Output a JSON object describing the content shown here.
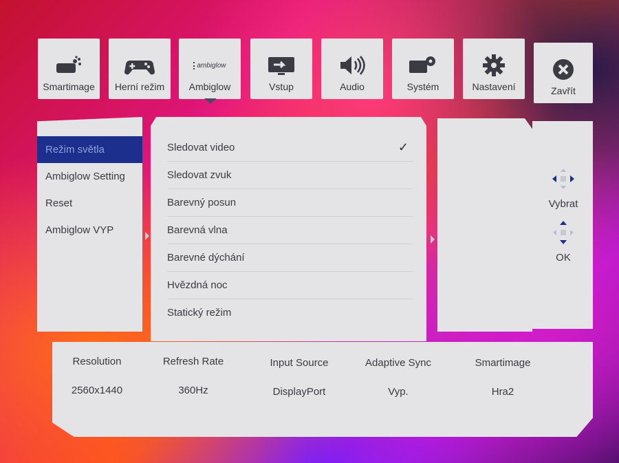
{
  "tabs": [
    {
      "label": "Smartimage",
      "icon": "smartimage-icon"
    },
    {
      "label": "Herní režim",
      "icon": "gamepad-icon"
    },
    {
      "label": "Ambiglow",
      "icon": "ambiglow-logo-icon",
      "logo_text": "ambiglow"
    },
    {
      "label": "Vstup",
      "icon": "input-icon"
    },
    {
      "label": "Audio",
      "icon": "speaker-icon"
    },
    {
      "label": "Systém",
      "icon": "system-icon"
    },
    {
      "label": "Nastavení",
      "icon": "gear-icon"
    },
    {
      "label": "Zavřít",
      "icon": "close-icon"
    }
  ],
  "active_tab": "Ambiglow",
  "left_menu": [
    "Režim světla",
    "Ambiglow Setting",
    "Reset",
    "Ambiglow VYP"
  ],
  "left_selected": "Režim světla",
  "mid_menu": [
    "Sledovat video",
    "Sledovat zvuk",
    "Barevný posun",
    "Barevná vlna",
    "Barevné dýchání",
    "Hvězdná noc",
    "Statický režim"
  ],
  "mid_checked": "Sledovat video",
  "help": {
    "select_label": "Vybrat",
    "ok_label": "OK"
  },
  "info": [
    {
      "key": "Resolution",
      "value": "2560x1440"
    },
    {
      "key": "Refresh Rate",
      "value": "360Hz"
    },
    {
      "key": "Input Source",
      "value": "DisplayPort"
    },
    {
      "key": "Adaptive Sync",
      "value": "Vyp."
    },
    {
      "key": "Smartimage",
      "value": "Hra2"
    }
  ],
  "colors": {
    "panel": "#e4e4e6",
    "selection": "#1c2f8c",
    "text": "#3a3a40"
  }
}
